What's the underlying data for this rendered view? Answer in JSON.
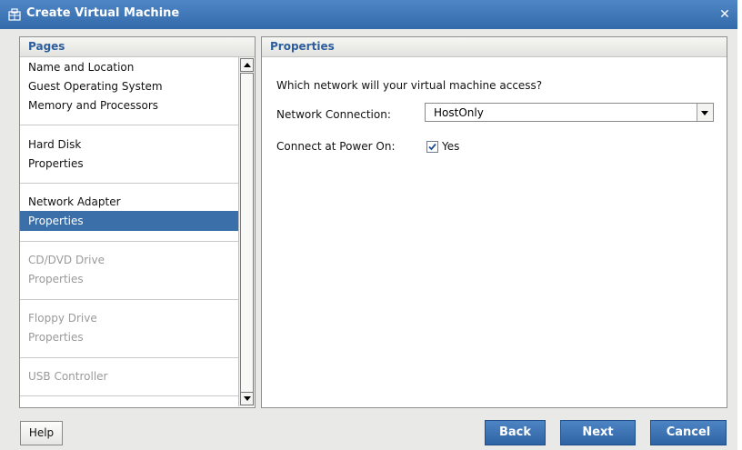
{
  "window": {
    "title": "Create Virtual Machine"
  },
  "left_pane": {
    "header": "Pages",
    "items": [
      {
        "label": "Name and Location",
        "state": "normal"
      },
      {
        "label": "Guest Operating System",
        "state": "normal"
      },
      {
        "label": "Memory and Processors",
        "state": "normal"
      },
      {
        "label": "Hard Disk",
        "state": "normal"
      },
      {
        "label": "Properties",
        "state": "normal"
      },
      {
        "label": "Network Adapter",
        "state": "normal"
      },
      {
        "label": "Properties",
        "state": "selected"
      },
      {
        "label": "CD/DVD Drive",
        "state": "disabled"
      },
      {
        "label": "Properties",
        "state": "disabled"
      },
      {
        "label": "Floppy Drive",
        "state": "disabled"
      },
      {
        "label": "Properties",
        "state": "disabled"
      },
      {
        "label": "USB Controller",
        "state": "disabled"
      }
    ]
  },
  "right_pane": {
    "header": "Properties",
    "question": "Which network will your virtual machine access?",
    "network_connection": {
      "label": "Network Connection:",
      "value": "HostOnly"
    },
    "connect_at_power_on": {
      "label": "Connect at Power On:",
      "checked": true,
      "option_label": "Yes"
    }
  },
  "buttons": {
    "help": "Help",
    "back": "Back",
    "next": "Next",
    "cancel": "Cancel"
  },
  "colors": {
    "accent": "#336aa9",
    "selected_row": "#3a6faa",
    "header_text": "#2c5e9d"
  }
}
